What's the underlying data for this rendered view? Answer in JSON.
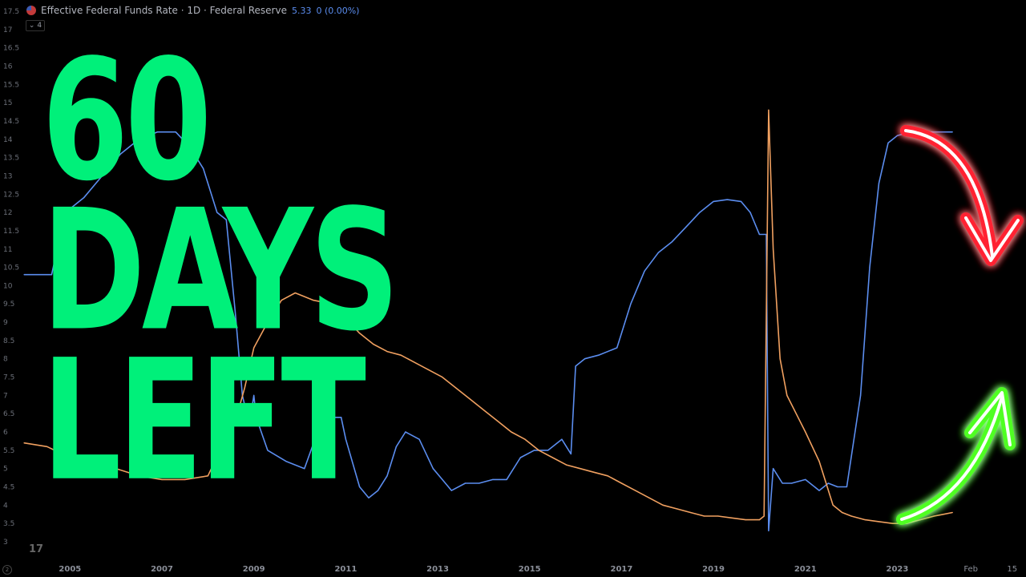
{
  "header": {
    "title": "Effective Federal Funds Rate · 1D · Federal Reserve",
    "value": "5.33",
    "change": "0 (0.00%)",
    "badge": "4",
    "corner": "2",
    "logo": "17"
  },
  "headline": {
    "line1": "60",
    "line2": "DAYS",
    "line3": "LEFT"
  },
  "colors": {
    "blue": "#5b8def",
    "orange": "#f0a060",
    "green": "#00f07a",
    "red_arrow": "#ff2030",
    "green_arrow": "#50ff20"
  },
  "chart_data": {
    "type": "line",
    "title": "Effective Federal Funds Rate · 1D · Federal Reserve",
    "ylim": [
      3,
      17.5
    ],
    "xlim": [
      2004,
      2025.8
    ],
    "x_ticks": [
      "2005",
      "2007",
      "2009",
      "2011",
      "2013",
      "2015",
      "2017",
      "2019",
      "2021",
      "2023",
      "Feb",
      "15"
    ],
    "y_ticks": [
      "3",
      "3.5",
      "4",
      "4.5",
      "5",
      "5.5",
      "6",
      "6.5",
      "7",
      "7.5",
      "8",
      "8.5",
      "9",
      "9.5",
      "10",
      "10.5",
      "11",
      "11.5",
      "12",
      "12.5",
      "13",
      "13.5",
      "14",
      "14.5",
      "15",
      "15.5",
      "16",
      "16.5",
      "17",
      "17.5"
    ],
    "series": [
      {
        "color": "#5b8def",
        "x": [
          2004.0,
          2004.3,
          2004.6,
          2004.9,
          2005.3,
          2005.7,
          2006.1,
          2006.5,
          2006.9,
          2007.3,
          2007.6,
          2007.9,
          2008.2,
          2008.4,
          2008.6,
          2008.75,
          2008.9,
          2009.0,
          2009.05,
          2009.3,
          2009.7,
          2010.1,
          2010.5,
          2010.9,
          2011.0,
          2011.3,
          2011.5,
          2011.7,
          2011.9,
          2012.1,
          2012.3,
          2012.6,
          2012.9,
          2013.1,
          2013.3,
          2013.6,
          2013.9,
          2014.2,
          2014.5,
          2014.8,
          2015.1,
          2015.4,
          2015.7,
          2015.9,
          2016.0,
          2016.2,
          2016.5,
          2016.9,
          2017.2,
          2017.5,
          2017.8,
          2018.1,
          2018.4,
          2018.7,
          2019.0,
          2019.3,
          2019.6,
          2019.8,
          2020.0,
          2020.15,
          2020.2,
          2020.3,
          2020.5,
          2020.7,
          2021.0,
          2021.3,
          2021.5,
          2021.7,
          2021.9,
          2022.2,
          2022.4,
          2022.6,
          2022.8,
          2023.0,
          2023.3,
          2023.6,
          2023.8,
          2024.0,
          2024.2
        ],
        "y": [
          10.3,
          10.3,
          10.3,
          12.0,
          12.4,
          13.0,
          13.6,
          14.0,
          14.2,
          14.2,
          13.8,
          13.2,
          12.0,
          11.8,
          9.2,
          7.0,
          6.2,
          7.0,
          6.4,
          5.5,
          5.2,
          5.0,
          6.4,
          6.4,
          5.8,
          4.5,
          4.2,
          4.4,
          4.8,
          5.6,
          6.0,
          5.8,
          5.0,
          4.7,
          4.4,
          4.6,
          4.6,
          4.7,
          4.7,
          5.3,
          5.5,
          5.5,
          5.8,
          5.4,
          7.8,
          8.0,
          8.1,
          8.3,
          9.5,
          10.4,
          10.9,
          11.2,
          11.6,
          12.0,
          12.3,
          12.35,
          12.3,
          12.0,
          11.4,
          11.4,
          3.3,
          5.0,
          4.6,
          4.6,
          4.7,
          4.4,
          4.6,
          4.5,
          4.5,
          7.0,
          10.5,
          12.8,
          13.9,
          14.1,
          14.2,
          14.2,
          14.2,
          14.2,
          14.2
        ]
      },
      {
        "color": "#f0a060",
        "x": [
          2004.0,
          2004.5,
          2005.0,
          2005.5,
          2006.0,
          2006.5,
          2007.0,
          2007.5,
          2008.0,
          2008.3,
          2008.6,
          2008.8,
          2009.0,
          2009.3,
          2009.6,
          2009.9,
          2010.3,
          2010.7,
          2011.0,
          2011.3,
          2011.6,
          2011.9,
          2012.2,
          2012.5,
          2012.8,
          2013.1,
          2013.4,
          2013.7,
          2014.0,
          2014.3,
          2014.6,
          2014.9,
          2015.2,
          2015.5,
          2015.8,
          2016.1,
          2016.4,
          2016.7,
          2017.0,
          2017.3,
          2017.6,
          2017.9,
          2018.2,
          2018.5,
          2018.8,
          2019.1,
          2019.4,
          2019.7,
          2020.0,
          2020.1,
          2020.2,
          2020.3,
          2020.45,
          2020.6,
          2020.8,
          2021.0,
          2021.3,
          2021.6,
          2021.8,
          2022.0,
          2022.3,
          2022.6,
          2022.9,
          2023.2,
          2023.5,
          2023.8,
          2024.0,
          2024.2
        ],
        "y": [
          5.7,
          5.6,
          5.3,
          5.1,
          5.0,
          4.8,
          4.7,
          4.7,
          4.8,
          5.6,
          6.3,
          7.2,
          8.3,
          9.0,
          9.6,
          9.8,
          9.6,
          9.5,
          9.1,
          8.7,
          8.4,
          8.2,
          8.1,
          7.9,
          7.7,
          7.5,
          7.2,
          6.9,
          6.6,
          6.3,
          6.0,
          5.8,
          5.5,
          5.3,
          5.1,
          5.0,
          4.9,
          4.8,
          4.6,
          4.4,
          4.2,
          4.0,
          3.9,
          3.8,
          3.7,
          3.7,
          3.65,
          3.6,
          3.6,
          3.7,
          14.8,
          11.0,
          8.0,
          7.0,
          6.5,
          6.0,
          5.2,
          4.0,
          3.8,
          3.7,
          3.6,
          3.55,
          3.5,
          3.5,
          3.6,
          3.7,
          3.75,
          3.8
        ]
      }
    ],
    "annotations": [
      "60 DAYS LEFT"
    ],
    "grid": false,
    "legend": "none"
  }
}
